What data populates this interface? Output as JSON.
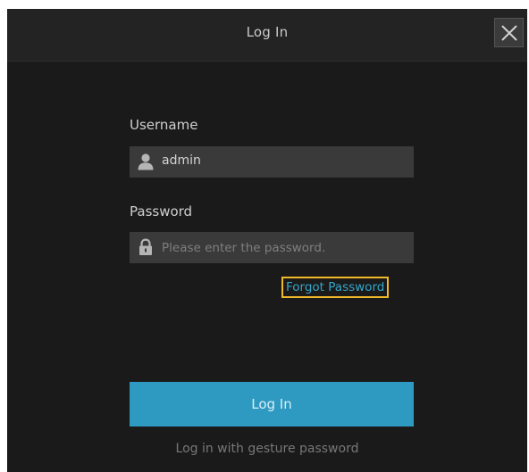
{
  "dialog": {
    "title": "Log In",
    "close_icon": "close-icon"
  },
  "username": {
    "label": "Username",
    "value": "admin",
    "icon": "user-icon"
  },
  "password": {
    "label": "Password",
    "placeholder": "Please enter the password.",
    "value": "",
    "icon": "lock-icon"
  },
  "forgot_password": {
    "label": "Forgot Password",
    "highlight_color": "#f0b92a"
  },
  "login_button": {
    "label": "Log In",
    "color": "#2e9ac1"
  },
  "gesture_login": {
    "label": "Log in with gesture password"
  }
}
